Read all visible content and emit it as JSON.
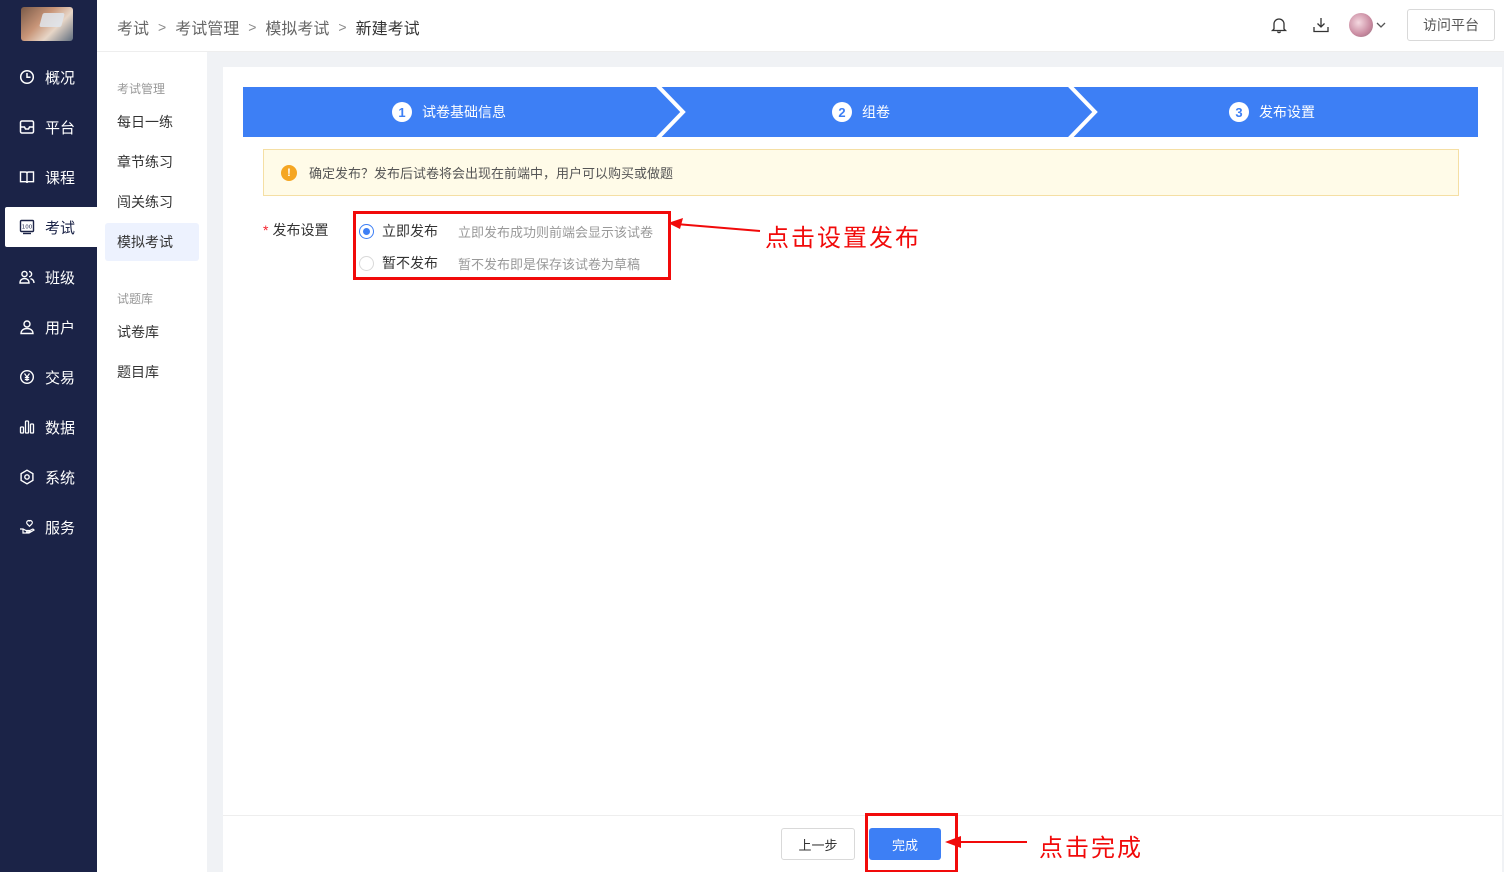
{
  "sidebar": {
    "items": [
      {
        "label": "概况",
        "icon": "clock-icon",
        "active": false
      },
      {
        "label": "平台",
        "icon": "inbox-icon",
        "active": false
      },
      {
        "label": "课程",
        "icon": "book-icon",
        "active": false
      },
      {
        "label": "考试",
        "icon": "exam-icon",
        "active": true
      },
      {
        "label": "班级",
        "icon": "people-icon",
        "active": false
      },
      {
        "label": "用户",
        "icon": "user-icon",
        "active": false
      },
      {
        "label": "交易",
        "icon": "yen-icon",
        "active": false
      },
      {
        "label": "数据",
        "icon": "bar-chart-icon",
        "active": false
      },
      {
        "label": "系统",
        "icon": "gear-icon",
        "active": false
      },
      {
        "label": "服务",
        "icon": "hand-heart-icon",
        "active": false
      }
    ]
  },
  "subnav": {
    "group1": "考试管理",
    "items1": [
      "每日一练",
      "章节练习",
      "闯关练习",
      "模拟考试"
    ],
    "group2": "试题库",
    "items2": [
      "试卷库",
      "题目库"
    ]
  },
  "header": {
    "breadcrumb": [
      "考试",
      "考试管理",
      "模拟考试",
      "新建考试"
    ],
    "visit_label": "访问平台"
  },
  "steps": [
    {
      "num": "1",
      "label": "试卷基础信息"
    },
    {
      "num": "2",
      "label": "组卷"
    },
    {
      "num": "3",
      "label": "发布设置"
    }
  ],
  "alert": {
    "text": "确定发布？发布后试卷将会出现在前端中，用户可以购买或做题"
  },
  "form": {
    "label": "发布设置",
    "required_mark": "*",
    "options": [
      {
        "label": "立即发布",
        "desc": "立即发布成功则前端会显示该试卷",
        "checked": true
      },
      {
        "label": "暂不发布",
        "desc": "暂不发布即是保存该试卷为草稿",
        "checked": false
      }
    ]
  },
  "annotations": {
    "publish_callout": "点击设置发布",
    "done_callout": "点击完成"
  },
  "footer": {
    "prev_label": "上一步",
    "done_label": "完成"
  },
  "colors": {
    "sidebar": "#1b2347",
    "primary": "#3d7ff5",
    "annotation": "#f10a0a"
  }
}
